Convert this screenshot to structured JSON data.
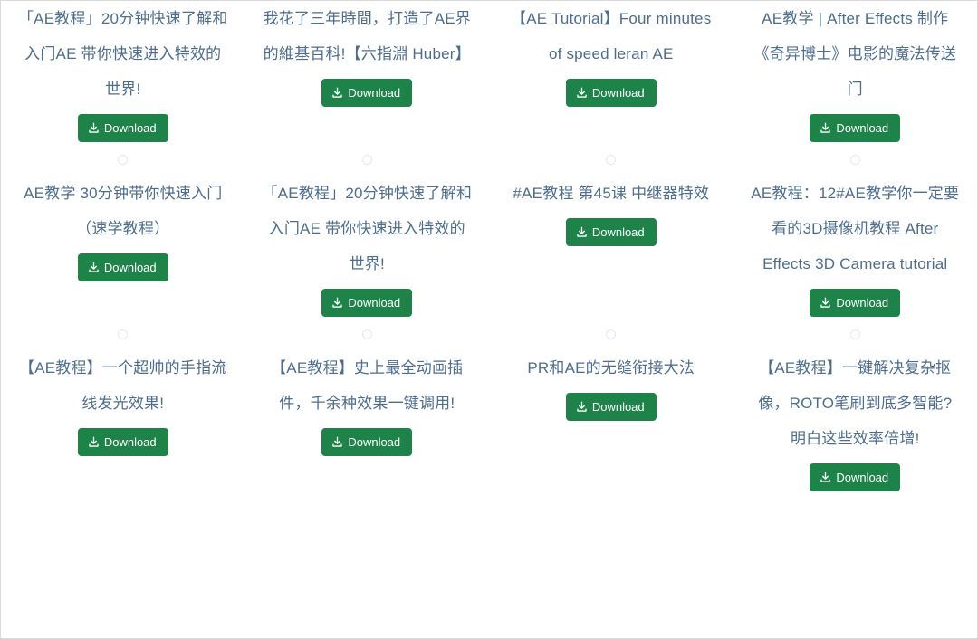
{
  "colors": {
    "title_text": "#4d6d8f",
    "button_bg": "#1d8348",
    "button_text": "#ffffff",
    "marker_border": "#e8e8e8",
    "page_border": "#d9d9d9",
    "background": "#ffffff"
  },
  "icons": {
    "download": "download-icon",
    "marker": "circle-marker-icon"
  },
  "button": {
    "download_label": "Download"
  },
  "grid": {
    "columns": 4,
    "rows": 3
  },
  "items": [
    {
      "title": "「AE教程」20分钟快速了解和入门AE 带你快速进入特效的世界!",
      "download_label": "Download",
      "row": 1,
      "col": 1
    },
    {
      "title": "我花了三年時間，打造了AE界的維基百科!【六指淵 Huber】",
      "download_label": "Download",
      "row": 1,
      "col": 2
    },
    {
      "title": "【AE Tutorial】Four minutes of speed leran AE",
      "download_label": "Download",
      "row": 1,
      "col": 3
    },
    {
      "title": "AE教学 | After Effects 制作《奇异博士》电影的魔法传送门",
      "download_label": "Download",
      "row": 1,
      "col": 4
    },
    {
      "title": "AE教学 30分钟带你快速入门（速学教程）",
      "download_label": "Download",
      "row": 2,
      "col": 1
    },
    {
      "title": "「AE教程」20分钟快速了解和入门AE 带你快速进入特效的世界!",
      "download_label": "Download",
      "row": 2,
      "col": 2
    },
    {
      "title": "#AE教程 第45课 中继器特效",
      "download_label": "Download",
      "row": 2,
      "col": 3
    },
    {
      "title": "AE教程：12#AE教学你一定要看的3D摄像机教程 After Effects 3D Camera tutorial",
      "download_label": "Download",
      "row": 2,
      "col": 4
    },
    {
      "title": "【AE教程】一个超帅的手指流线发光效果!",
      "download_label": "Download",
      "row": 3,
      "col": 1
    },
    {
      "title": "【AE教程】史上最全动画插件，千余种效果一键调用!",
      "download_label": "Download",
      "row": 3,
      "col": 2
    },
    {
      "title": "PR和AE的无缝衔接大法",
      "download_label": "Download",
      "row": 3,
      "col": 3
    },
    {
      "title": "【AE教程】一键解决复杂抠像，ROTO笔刷到底多智能? 明白这些效率倍增!",
      "download_label": "Download",
      "row": 3,
      "col": 4
    }
  ]
}
